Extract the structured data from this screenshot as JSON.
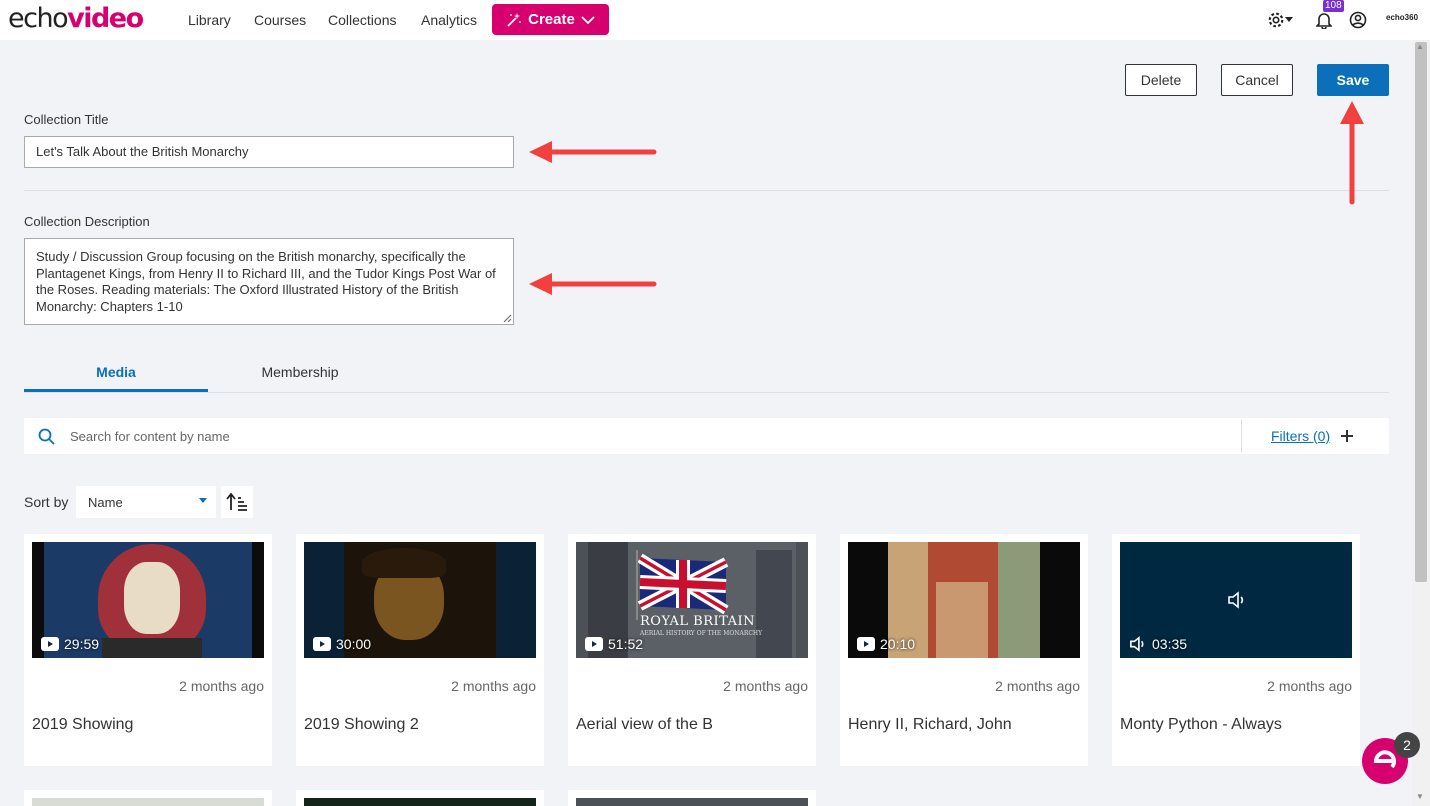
{
  "nav": {
    "logo_echo": "echo",
    "logo_video": "video",
    "links": [
      "Library",
      "Courses",
      "Collections",
      "Analytics"
    ],
    "create_label": "Create",
    "notification_count": "108",
    "brand": "echo360"
  },
  "actions": {
    "delete": "Delete",
    "cancel": "Cancel",
    "save": "Save"
  },
  "form": {
    "title_label": "Collection Title",
    "title_value": "Let's Talk About the British Monarchy",
    "description_label": "Collection Description",
    "description_value": "Study / Discussion Group focusing on the British monarchy, specifically the Plantagenet Kings, from Henry II to Richard III, and the Tudor Kings Post War of the Roses. Reading materials: The Oxford Illustrated History of the British Monarchy: Chapters 1-10"
  },
  "tabs": [
    "Media",
    "Membership"
  ],
  "search": {
    "placeholder": "Search for content by name",
    "filters_label": "Filters (0)"
  },
  "sort": {
    "label": "Sort by",
    "value": "Name"
  },
  "cards": [
    {
      "duration": "29:59",
      "date": "2 months ago",
      "title": "2019 Showing",
      "type": "video"
    },
    {
      "duration": "30:00",
      "date": "2 months ago",
      "title": "2019 Showing 2",
      "type": "video"
    },
    {
      "duration": "51:52",
      "date": "2 months ago",
      "title": "Aerial view of the B",
      "type": "video",
      "overlay_title": "ROYAL BRITAIN",
      "overlay_sub": "AERIAL HISTORY OF THE MONARCHY"
    },
    {
      "duration": "20:10",
      "date": "2 months ago",
      "title": "Henry II, Richard, John",
      "type": "video"
    },
    {
      "duration": "03:35",
      "date": "2 months ago",
      "title": "Monty Python - Always",
      "type": "audio"
    }
  ],
  "fab_badge": "2",
  "colors": {
    "brand": "#d6006f",
    "primary": "#0b6fba",
    "annotation_arrow": "#f04040"
  }
}
